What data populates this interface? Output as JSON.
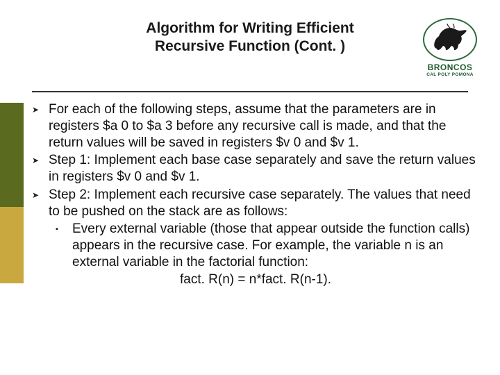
{
  "header": {
    "title_line1": "Algorithm for Writing Efficient",
    "title_line2": "Recursive Function (Cont. )"
  },
  "logo": {
    "brand": "BRONCOS",
    "subbrand": "CAL POLY POMONA"
  },
  "bullets": [
    {
      "text": "For each of the following steps, assume that the parameters are in registers $a 0 to $a 3 before any recursive call is made, and that the return values will be saved in registers $v 0 and $v 1."
    },
    {
      "text": "Step 1: Implement each base case separately and save the return values in registers $v 0 and $v 1."
    },
    {
      "text": "Step 2: Implement each recursive case separately. The values that need to be pushed on the stack are as follows:"
    }
  ],
  "subbullets": [
    {
      "text": "Every external variable (those that appear outside the function calls) appears in the recursive case. For example, the variable n is an external variable in the factorial function:"
    }
  ],
  "formula": "fact. R(n) = n*fact. R(n-1).",
  "glyphs": {
    "arrow": "➤",
    "square": "▪"
  }
}
